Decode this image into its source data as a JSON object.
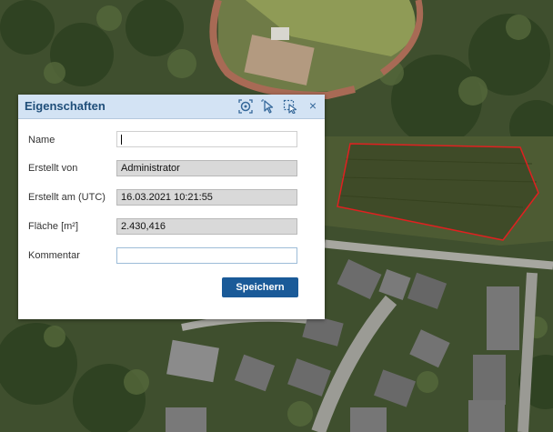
{
  "dialog": {
    "title": "Eigenschaften",
    "tools": [
      {
        "icon": "zoom-to-feature-icon"
      },
      {
        "icon": "select-pointer-icon"
      },
      {
        "icon": "edit-geometry-icon"
      }
    ],
    "close_icon": "close-icon",
    "close_glyph": "×",
    "fields": {
      "name": {
        "label": "Name",
        "value": ""
      },
      "erstellt_von": {
        "label": "Erstellt von",
        "value": "Administrator"
      },
      "erstellt_am": {
        "label": "Erstellt am (UTC)",
        "value": "16.03.2021 10:21:55"
      },
      "flaeche": {
        "label": "Fläche [m²]",
        "value": "2.430,416"
      },
      "kommentar": {
        "label": "Kommentar",
        "value": ""
      }
    },
    "save_label": "Speichern"
  },
  "colors": {
    "header_bg": "#d3e3f4",
    "title": "#1f4e79",
    "button": "#1a5a98",
    "polygon": "#e02020"
  }
}
